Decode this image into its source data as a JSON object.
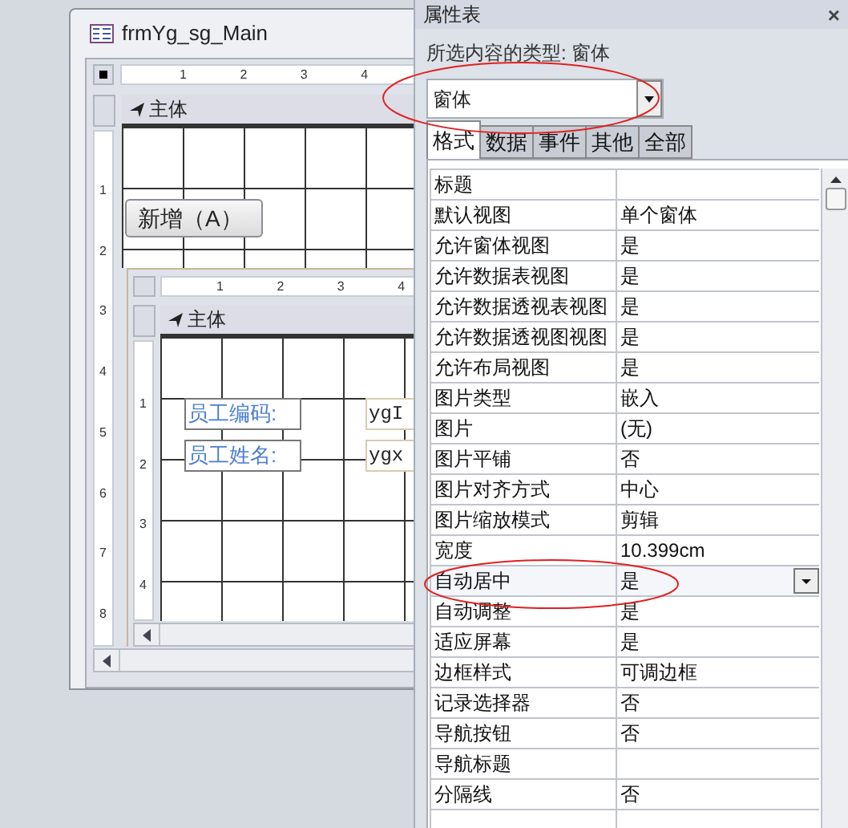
{
  "form_window": {
    "title": "frmYg_sg_Main",
    "ruler_marks": [
      "1",
      "2",
      "3",
      "4"
    ],
    "vertical_ruler_marks": [
      "1",
      "2",
      "3",
      "4",
      "5",
      "6",
      "7",
      "8"
    ],
    "section": "主体",
    "button": "新增（A）",
    "subform": {
      "ruler_marks": [
        "1",
        "2",
        "3",
        "4"
      ],
      "vertical_ruler_marks": [
        "1",
        "2",
        "3",
        "4"
      ],
      "section": "主体",
      "fields": [
        {
          "label": "员工编码:",
          "value": "ygI"
        },
        {
          "label": "员工姓名:",
          "value": "ygx"
        }
      ]
    }
  },
  "property_sheet": {
    "title": "属性表",
    "close": "×",
    "selection_type": "所选内容的类型: 窗体",
    "object_combo": "窗体",
    "tabs": [
      {
        "label": "格式",
        "selected": true
      },
      {
        "label": "数据",
        "selected": false
      },
      {
        "label": "事件",
        "selected": false
      },
      {
        "label": "其他",
        "selected": false
      },
      {
        "label": "全部",
        "selected": false
      }
    ],
    "properties": [
      {
        "name": "标题",
        "selected": false
      },
      {
        "name": "默认视图",
        "value": "单个窗体",
        "selected": false
      },
      {
        "name": "允许窗体视图",
        "value": "是",
        "selected": false
      },
      {
        "name": "允许数据表视图",
        "value": "是",
        "selected": false
      },
      {
        "name": "允许数据透视表视图",
        "value": "是",
        "selected": false
      },
      {
        "name": "允许数据透视图视图",
        "value": "是",
        "selected": false
      },
      {
        "name": "允许布局视图",
        "value": "是",
        "selected": false
      },
      {
        "name": "图片类型",
        "value": "嵌入",
        "selected": false
      },
      {
        "name": "图片",
        "value": "(无)",
        "selected": false
      },
      {
        "name": "图片平铺",
        "value": "否",
        "selected": false
      },
      {
        "name": "图片对齐方式",
        "value": "中心",
        "selected": false
      },
      {
        "name": "图片缩放模式",
        "value": "剪辑",
        "selected": false
      },
      {
        "name": "宽度",
        "value": "10.399cm",
        "selected": false
      },
      {
        "name": "自动居中",
        "value": "是",
        "selected": true
      },
      {
        "name": "自动调整",
        "value": "是",
        "selected": false
      },
      {
        "name": "适应屏幕",
        "value": "是",
        "selected": false
      },
      {
        "name": "边框样式",
        "value": "可调边框",
        "selected": false
      },
      {
        "name": "记录选择器",
        "value": "否",
        "selected": false
      },
      {
        "name": "导航按钮",
        "value": "否",
        "selected": false
      },
      {
        "name": "导航标题",
        "selected": false
      },
      {
        "name": "分隔线",
        "value": "否",
        "selected": false
      }
    ]
  }
}
